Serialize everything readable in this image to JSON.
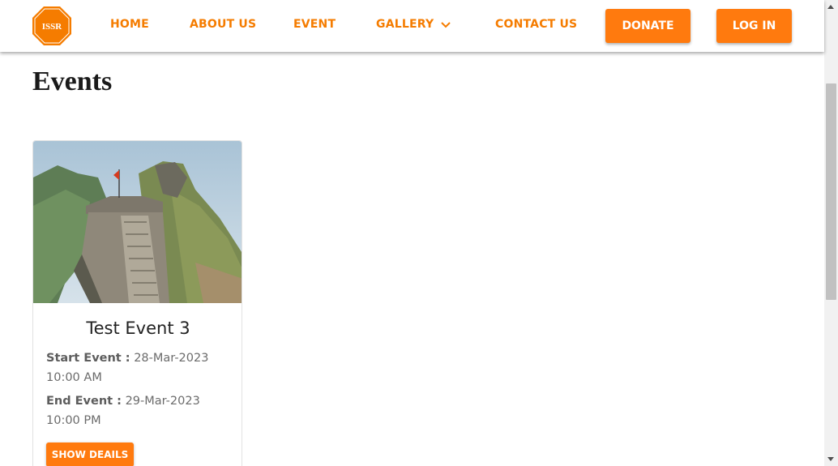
{
  "logo": {
    "text": "ISSR",
    "color": "#f57c00"
  },
  "nav": {
    "home": "HOME",
    "about": "ABOUT US",
    "event": "EVENT",
    "gallery": "GALLERY",
    "contact": "CONTACT US",
    "donate": "DONATE",
    "login": "LOG IN"
  },
  "icons": {
    "gallery_dropdown": "chevron-down-icon"
  },
  "page": {
    "title": "Events"
  },
  "events": [
    {
      "title": "Test Event 3",
      "start_label": "Start Event :",
      "start_value": "28-Mar-2023 10:00 AM",
      "end_label": "End Event :",
      "end_value": "29-Mar-2023 10:00 PM",
      "button": "SHOW DEAILS"
    }
  ],
  "colors": {
    "accent": "#ff7a0e",
    "nav_text": "#f57c00"
  }
}
